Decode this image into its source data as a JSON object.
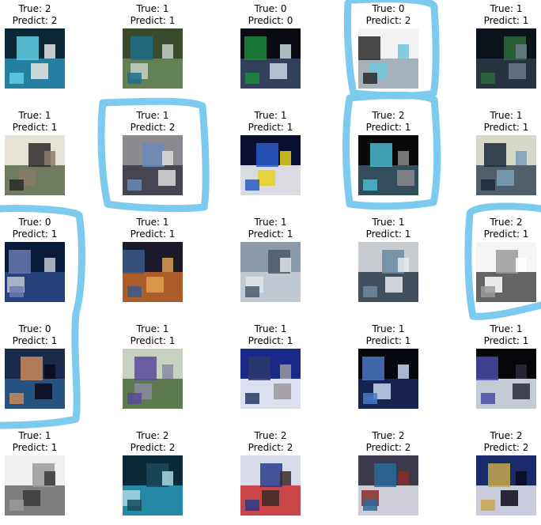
{
  "grid": [
    {
      "true_text": "True: 2",
      "pred_text": "Predict: 2",
      "thumb": "crowd in blue",
      "colors": [
        "#0c2736",
        "#2a8fb3",
        "#5fd0e8",
        "#e8e8e0"
      ]
    },
    {
      "true_text": "True: 1",
      "pred_text": "Predict: 1",
      "thumb": "street with banner",
      "colors": [
        "#3b4a2c",
        "#6a8a5a",
        "#1f6e8c",
        "#c8d0c8"
      ]
    },
    {
      "true_text": "True: 0",
      "pred_text": "Predict: 0",
      "thumb": "poster with people",
      "colors": [
        "#0a0a12",
        "#3a4a6a",
        "#1a8a3a",
        "#c8d8e0"
      ]
    },
    {
      "true_text": "True: 0",
      "pred_text": "Predict: 2",
      "thumb": "building",
      "colors": [
        "#f2f2f2",
        "#9aa6b0",
        "#2a2a2a",
        "#6fc8dc"
      ]
    },
    {
      "true_text": "True: 1",
      "pred_text": "Predict: 1",
      "thumb": "night street",
      "colors": [
        "#0c121a",
        "#2e3a48",
        "#2a6a3a",
        "#6a7a8a"
      ]
    },
    {
      "true_text": "True: 1",
      "pred_text": "Predict: 1",
      "thumb": "protest crowd",
      "colors": [
        "#e6e2d8",
        "#5a6a4a",
        "#2a2a2a",
        "#8a7a6a"
      ]
    },
    {
      "true_text": "True: 1",
      "pred_text": "Predict: 2",
      "thumb": "crowd aerial",
      "colors": [
        "#8a8a90",
        "#3a3a48",
        "#6a8ab8",
        "#dcdcdc"
      ]
    },
    {
      "true_text": "True: 1",
      "pred_text": "Predict: 1",
      "thumb": "truck infographic",
      "colors": [
        "#0a0e30",
        "#ffffff",
        "#2a5ac8",
        "#e8d020"
      ]
    },
    {
      "true_text": "True: 2",
      "pred_text": "Predict: 1",
      "thumb": "people at night",
      "colors": [
        "#0a0a0a",
        "#3a5a6a",
        "#4ab8d0",
        "#8a8a8a"
      ]
    },
    {
      "true_text": "True: 1",
      "pred_text": "Predict: 1",
      "thumb": "crosswalk crowd",
      "colors": [
        "#d8d8c8",
        "#3a4a5a",
        "#1a2a3a",
        "#7aa0b8"
      ]
    },
    {
      "true_text": "True: 0",
      "pred_text": "Predict: 1",
      "thumb": "police line",
      "colors": [
        "#0a1a3a",
        "#2a4a8a",
        "#6a7ab0",
        "#c0c8d0"
      ]
    },
    {
      "true_text": "True: 1",
      "pred_text": "Predict: 1",
      "thumb": "night rally",
      "colors": [
        "#1a1a2a",
        "#c86a2a",
        "#3a5a8a",
        "#e0a050"
      ]
    },
    {
      "true_text": "True: 1",
      "pred_text": "Predict: 1",
      "thumb": "blurry scene",
      "colors": [
        "#8a9aa8",
        "#c8d0d8",
        "#4a5a6a",
        "#e0e4e8"
      ]
    },
    {
      "true_text": "True: 1",
      "pred_text": "Predict: 1",
      "thumb": "crowd at building",
      "colors": [
        "#c8ccd0",
        "#2a3a4a",
        "#6a8aa0",
        "#e8eaec"
      ]
    },
    {
      "true_text": "True: 2",
      "pred_text": "Predict: 1",
      "thumb": "text document",
      "colors": [
        "#f4f4f4",
        "#4a4a4a",
        "#9a9a9a",
        "#ffffff"
      ]
    },
    {
      "true_text": "True: 0",
      "pred_text": "Predict: 1",
      "thumb": "man speaking",
      "colors": [
        "#1a2a4a",
        "#2a5a8a",
        "#c88a5a",
        "#0a0a1a"
      ]
    },
    {
      "true_text": "True: 1",
      "pred_text": "Predict: 1",
      "thumb": "monument steps",
      "colors": [
        "#c8d0c0",
        "#4a6a3a",
        "#5a4a9a",
        "#8a8aa0"
      ]
    },
    {
      "true_text": "True: 1",
      "pred_text": "Predict: 1",
      "thumb": "thai text poster",
      "colors": [
        "#1a2a8a",
        "#ffffff",
        "#2a3a6a",
        "#9a9a9a"
      ]
    },
    {
      "true_text": "True: 1",
      "pred_text": "Predict: 1",
      "thumb": "night crowd lights",
      "colors": [
        "#05060e",
        "#1a2a5a",
        "#4a7ac8",
        "#c8d8f0"
      ]
    },
    {
      "true_text": "True: 1",
      "pred_text": "Predict: 1",
      "thumb": "lit building at night",
      "colors": [
        "#05050a",
        "#e8eef8",
        "#4a4aa8",
        "#2a2a3a"
      ]
    },
    {
      "true_text": "True: 1",
      "pred_text": "Predict: 1",
      "thumb": "three finger salute",
      "colors": [
        "#f0f0f0",
        "#6a6a6a",
        "#9a9a9a",
        "#3a3a3a"
      ]
    },
    {
      "true_text": "True: 2",
      "pred_text": "Predict: 2",
      "thumb": "crowd cyan",
      "colors": [
        "#0a2a3a",
        "#2a9ab8",
        "#1a4a5a",
        "#a8d8e8"
      ]
    },
    {
      "true_text": "True: 2",
      "pred_text": "Predict: 2",
      "thumb": "official with flag",
      "colors": [
        "#d8dce8",
        "#c82a2a",
        "#2a3a8a",
        "#3a2a2a"
      ]
    },
    {
      "true_text": "True: 2",
      "pred_text": "Predict: 2",
      "thumb": "people in uniform",
      "colors": [
        "#3a3a4a",
        "#e8e8f0",
        "#2a6a9a",
        "#8a2a2a"
      ]
    },
    {
      "true_text": "True: 2",
      "pred_text": "Predict: 2",
      "thumb": "officials in white",
      "colors": [
        "#1a2a6a",
        "#e8e8f0",
        "#c8a84a",
        "#0a0a1a"
      ]
    }
  ],
  "highlight_color": "#7ccbef"
}
